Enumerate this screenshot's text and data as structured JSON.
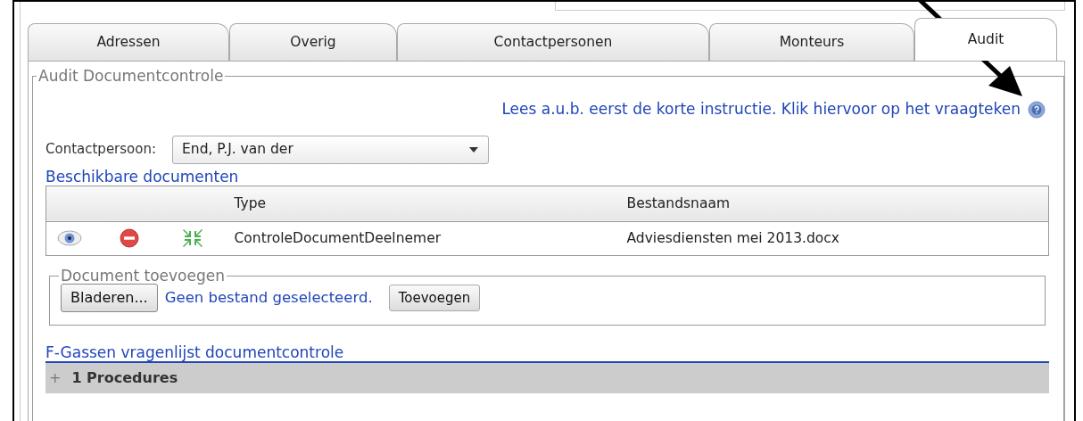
{
  "tabs": [
    {
      "label": "Adressen",
      "selected": false
    },
    {
      "label": "Overig",
      "selected": false
    },
    {
      "label": "Contactpersonen",
      "selected": false
    },
    {
      "label": "Monteurs",
      "selected": false
    },
    {
      "label": "Audit",
      "selected": true
    }
  ],
  "audit": {
    "legend": "Audit Documentcontrole",
    "instruction": "Lees a.u.b. eerst de korte instructie. Klik hiervoor op het vraagteken",
    "contact": {
      "label": "Contactpersoon:",
      "value": "End,  P.J. van der"
    },
    "documents_title": "Beschikbare documenten",
    "table": {
      "columns": [
        "Type",
        "Bestandsnaam"
      ],
      "rows": [
        {
          "type": "ControleDocumentDeelnemer",
          "filename": "Adviesdiensten mei 2013.docx"
        }
      ]
    },
    "add_document": {
      "legend": "Document toevoegen",
      "browse_button": "Bladeren...",
      "file_status": "Geen bestand geselecteerd.",
      "add_button": "Toevoegen"
    },
    "questionnaire_title": "F-Gassen vragenlijst documentcontrole",
    "sections": [
      {
        "toggle": "+",
        "label": "1 Procedures"
      }
    ]
  }
}
